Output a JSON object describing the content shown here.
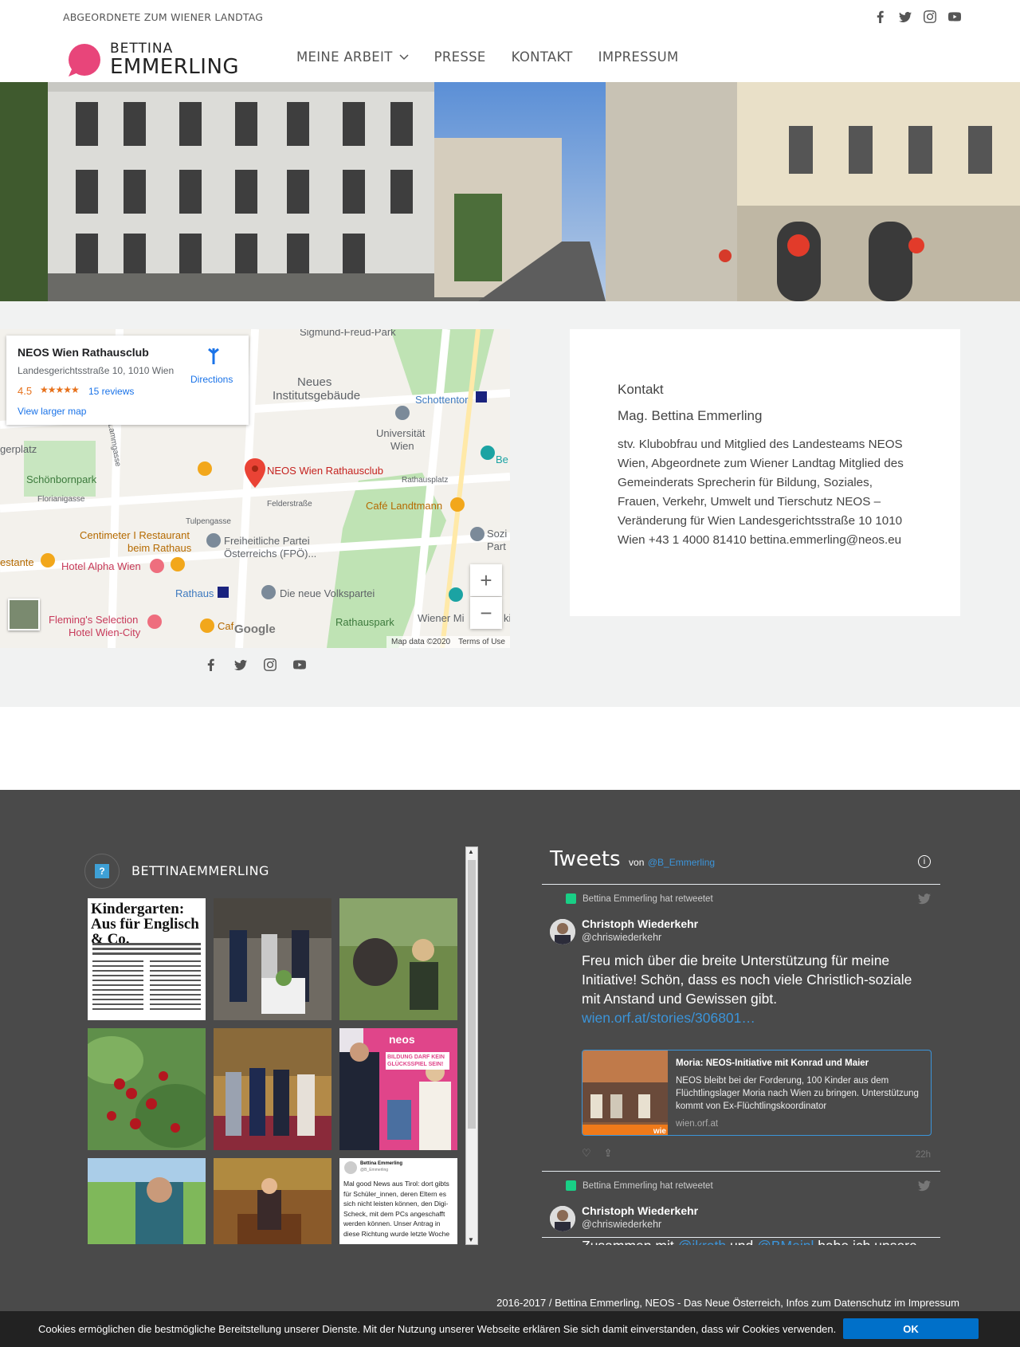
{
  "header": {
    "tagline": "ABGEORDNETE ZUM WIENER LANDTAG",
    "social": [
      "facebook-icon",
      "twitter-icon",
      "instagram-icon",
      "youtube-icon"
    ],
    "logo_first": "BETTINA",
    "logo_last": "EMMERLING",
    "brand_color": "#e8457a"
  },
  "nav": {
    "items": [
      {
        "label": "MEINE ARBEIT",
        "has_dropdown": true
      },
      {
        "label": "PRESSE"
      },
      {
        "label": "KONTAKT"
      },
      {
        "label": "IMPRESSUM"
      }
    ]
  },
  "map": {
    "place_name": "NEOS Wien Rathausclub",
    "address": "Landesgerichtsstraße 10, 1010 Wien",
    "rating": "4.5",
    "stars": "★★★★★",
    "reviews": "15 reviews",
    "larger_map": "View larger map",
    "directions": "Directions",
    "pin_label": "NEOS Wien Rathausclub",
    "labels": {
      "sigmund": "Sigmund-Freud-Park",
      "neues": "Neues",
      "institut": "Institutsgebäude",
      "schottentor": "Schottentor",
      "uni1": "Universität",
      "uni2": "Wien",
      "gerplatz": "gerplatz",
      "schoenborn": "Schönbornpark",
      "lammgasse": "Lammgasse",
      "florianigasse": "Florianigasse",
      "tulpengasse": "Tulpengasse",
      "felderstrasse": "Felderstraße",
      "rathausplatz": "Rathausplatz",
      "cafe_landtmann": "Café Landtmann",
      "centimeter1": "Centimeter I Restaurant",
      "centimeter2": "beim Rathaus",
      "fpoe1": "Freiheitliche Partei",
      "fpoe2": "Österreichs (FPÖ)...",
      "estante": "estante",
      "alpha": "Hotel Alpha Wien",
      "rathaus": "Rathaus",
      "volkspartei": "Die neue Volkspartei",
      "flemings1": "Fleming's Selection",
      "flemings2": "Hotel Wien-City",
      "rathauspark": "Rathauspark",
      "wienermi": "Wiener Mi",
      "sozi1": "Sozi",
      "sozi2": "Part",
      "be": "Be",
      "cafe": "Caf",
      "ki": "ki",
      "google": "Google",
      "map_data": "Map data ©2020",
      "terms": "Terms of Use"
    }
  },
  "contact": {
    "title": "Kontakt",
    "name": "Mag. Bettina Emmerling",
    "body": "stv. Klubobfrau und Mitglied des Landesteams NEOS Wien, Abgeordnete zum Wiener Landtag Mitglied des Gemeinderats Sprecherin für Bildung, Soziales, Frauen, Verkehr, Umwelt und Tierschutz NEOS – Veränderung für Wien Landesgerichtsstraße 10 1010 Wien +43 1 4000 81410 bettina.emmerling@neos.eu"
  },
  "instagram": {
    "username": "BETTINAEMMERLING",
    "tile1_headline": "Kindergarten: Aus für Englisch & Co.",
    "tile9_name": "Bettina Emmerling",
    "tile9_handle": "@B_Emmerling",
    "tile9_text": "Mal good News aus Tirol: dort gibts für Schüler_innen, deren Eltern es sich nicht leisten können, den Digi-Scheck, mit dem PCs angeschafft werden können. Unser Antrag in diese Richtung wurde letzte Woche",
    "tile6_banner": "neos",
    "tile6_sign": "BILDUNG DARF KEIN GLÜCKSSPIEL SEIN!"
  },
  "tweets": {
    "title": "Tweets",
    "von": "von",
    "handle": "@B_Emmerling",
    "items": [
      {
        "retweet_line": "Bettina Emmerling hat retweetet",
        "name": "Christoph Wiederkehr",
        "user": "@chriswiederkehr",
        "text": "Freu mich über die breite Unterstützung für meine Initiative! Schön, dass es noch viele  Christlich-soziale mit Anstand und Gewissen gibt.",
        "link": "wien.orf.at/stories/306801…",
        "card_title": "Moria: NEOS-Initiative mit Konrad und Maier",
        "card_desc": "NEOS bleibt bei der Forderung, 100 Kinder aus dem Flüchtlingslager Moria nach Wien zu bringen. Unterstützung kommt von Ex-Flüchtlingskoordinator",
        "card_domain": "wien.orf.at",
        "card_badge": "wie",
        "time": "22h"
      },
      {
        "retweet_line": "Bettina Emmerling hat retweetet",
        "name": "Christoph Wiederkehr",
        "user": "@chriswiederkehr",
        "text_a": "Zusammen mit ",
        "mention1": "@jkroth",
        "text_b": " und ",
        "mention2": "@BMeinl",
        "text_c": " habe ich unsere"
      }
    ]
  },
  "footer": {
    "text": "2016-2017 / Bettina Emmerling, NEOS - Das Neue Österreich, Infos zum Datenschutz im Impressum"
  },
  "cookie": {
    "text": "Cookies ermöglichen die bestmögliche Bereitstellung unserer Dienste. Mit der Nutzung unserer Webseite erklären Sie sich damit einverstanden, dass wir Cookies verwenden.",
    "button": "OK"
  }
}
